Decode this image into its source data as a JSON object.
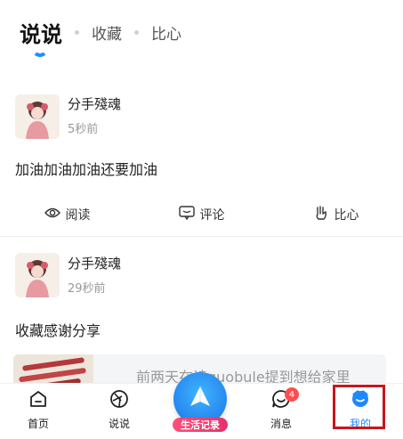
{
  "top_tabs": {
    "active": "说说",
    "items": [
      "收藏",
      "比心"
    ]
  },
  "posts": [
    {
      "username": "分手殘魂",
      "time": "5秒前",
      "content": "加油加油加油还要加油",
      "actions": {
        "read": "阅读",
        "comment": "评论",
        "like": "比心"
      }
    },
    {
      "username": "分手殘魂",
      "time": "29秒前",
      "content": "收藏感谢分享",
      "link_text": "前两天在读quobule提到想给家里"
    }
  ],
  "bottom_nav": {
    "home": "首页",
    "shuoshuo": "说说",
    "center": "生活记录",
    "messages": "消息",
    "messages_badge": "4",
    "me": "我的"
  },
  "colors": {
    "accent": "#1e88ff",
    "badge": "#ff4d4f",
    "highlight": "#c8161d",
    "center_label": "#e7306a"
  },
  "icons": [
    "eye-icon",
    "comment-icon",
    "heart-hand-icon",
    "home-icon",
    "aperture-icon",
    "paper-plane-icon",
    "message-smile-icon",
    "me-face-icon"
  ]
}
